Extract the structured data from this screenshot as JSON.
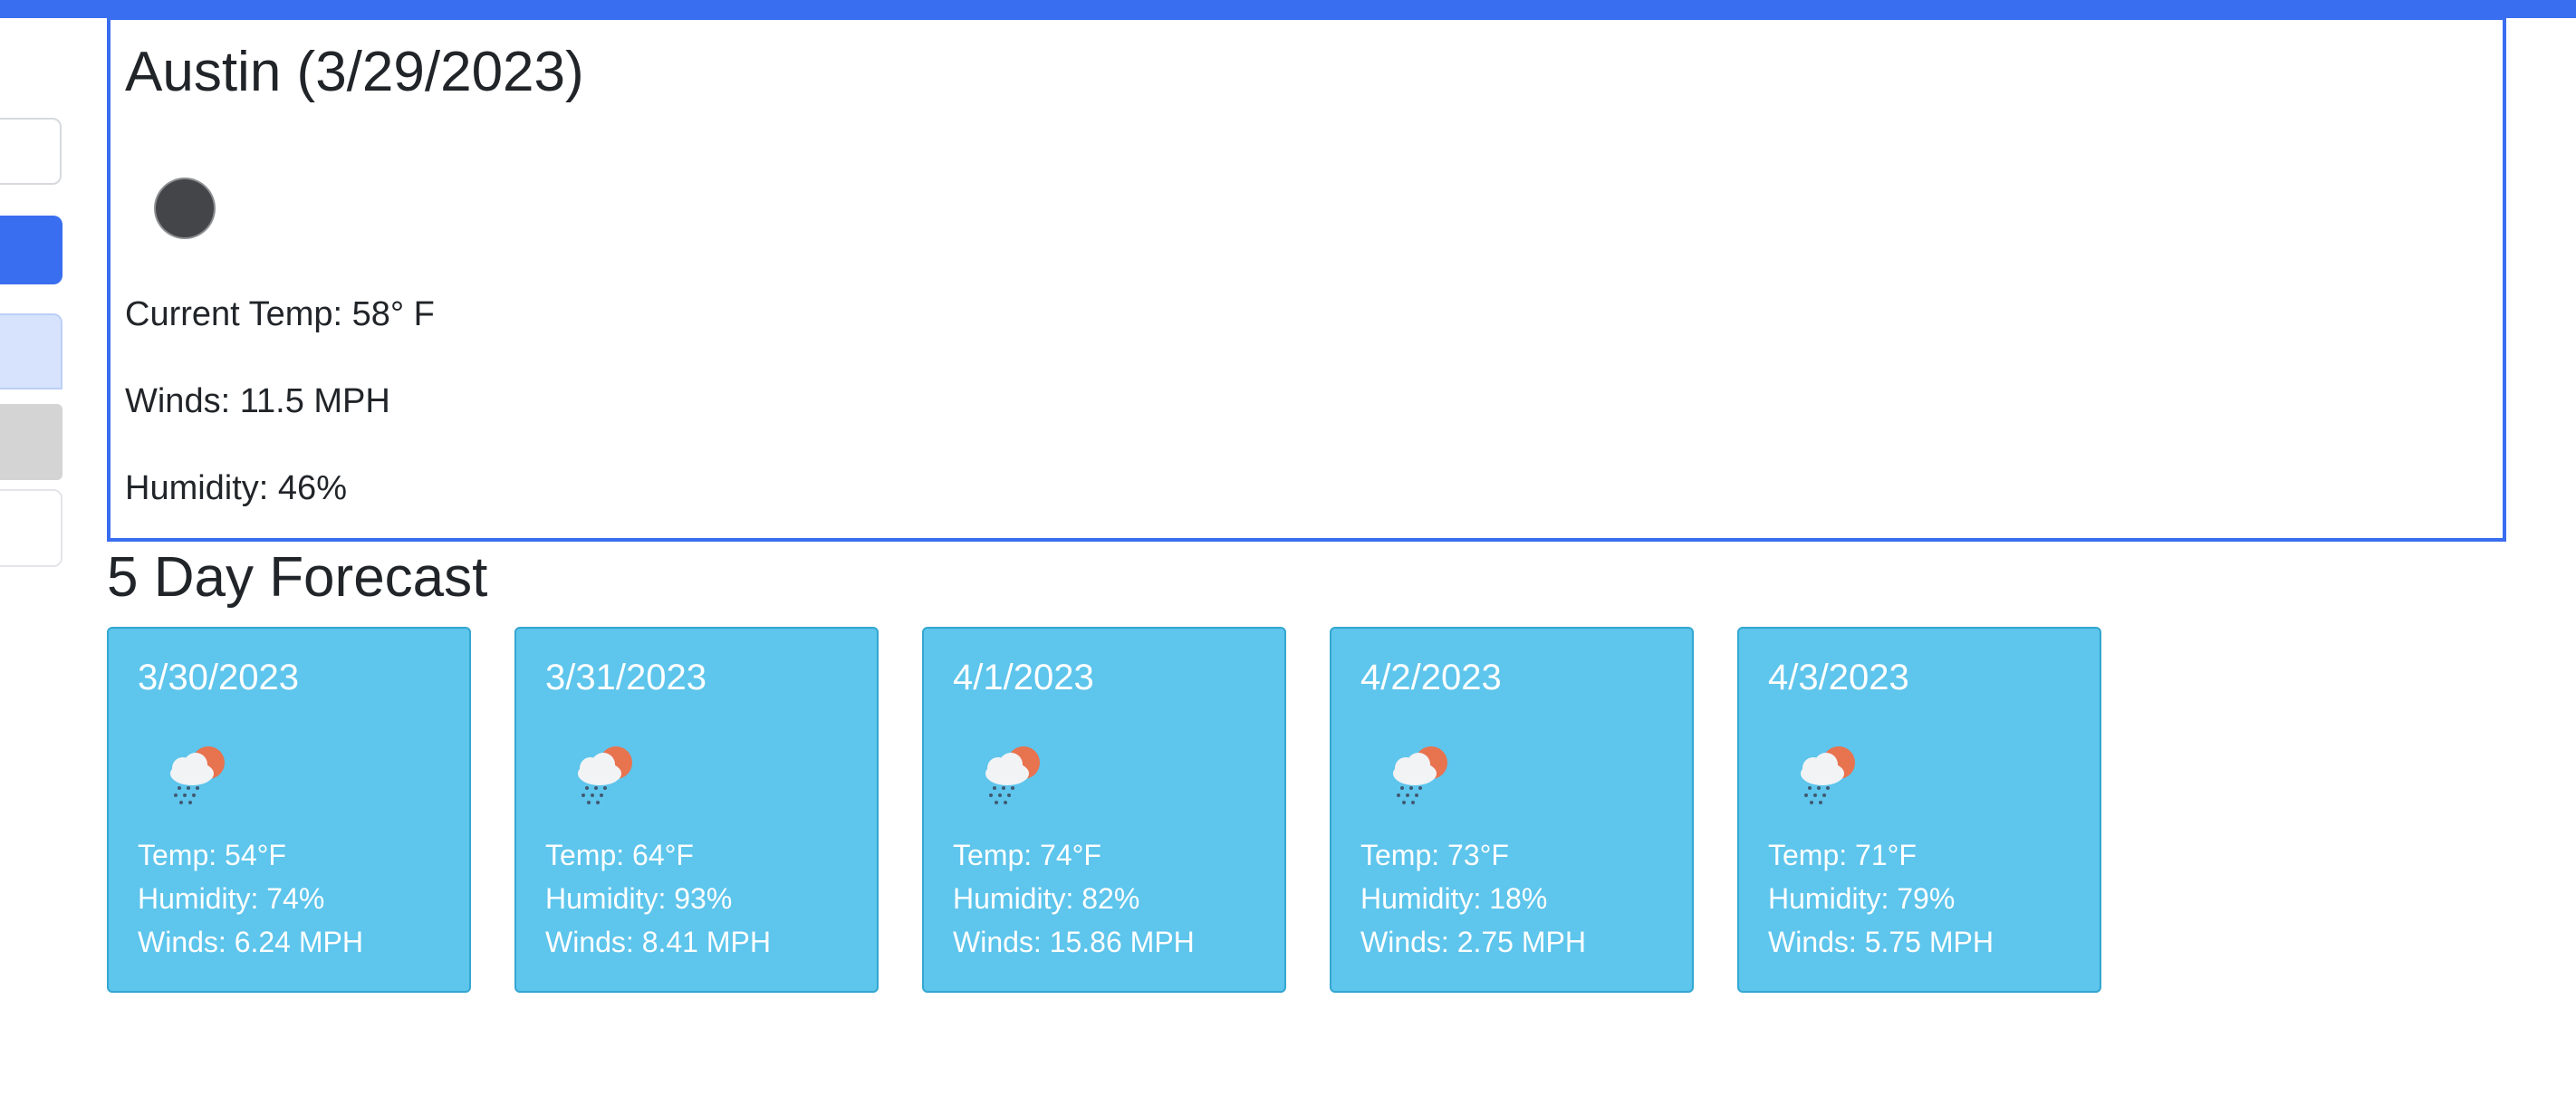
{
  "current": {
    "title": "Austin (3/29/2023)",
    "icon": "clear-night-moon-icon",
    "temp": "Current Temp: 58° F",
    "wind": "Winds: 11.5 MPH",
    "humidity": "Humidity: 46%"
  },
  "forecast": {
    "title": "5 Day Forecast",
    "icon": "sun-behind-rain-cloud-icon",
    "days": [
      {
        "date": "3/30/2023",
        "temp": "Temp: 54°F",
        "humidity": "Humidity: 74%",
        "wind": "Winds: 6.24 MPH"
      },
      {
        "date": "3/31/2023",
        "temp": "Temp: 64°F",
        "humidity": "Humidity: 93%",
        "wind": "Winds: 8.41 MPH"
      },
      {
        "date": "4/1/2023",
        "temp": "Temp: 74°F",
        "humidity": "Humidity: 82%",
        "wind": "Winds: 15.86 MPH"
      },
      {
        "date": "4/2/2023",
        "temp": "Temp: 73°F",
        "humidity": "Humidity: 18%",
        "wind": "Winds: 2.75 MPH"
      },
      {
        "date": "4/3/2023",
        "temp": "Temp: 71°F",
        "humidity": "Humidity: 79%",
        "wind": "Winds: 5.75 MPH"
      }
    ]
  },
  "colors": {
    "accent": "#3a6ef0",
    "card": "#5ec5ec",
    "history_active": "#d7e3fd",
    "history_inactive": "#d4d4d4"
  }
}
